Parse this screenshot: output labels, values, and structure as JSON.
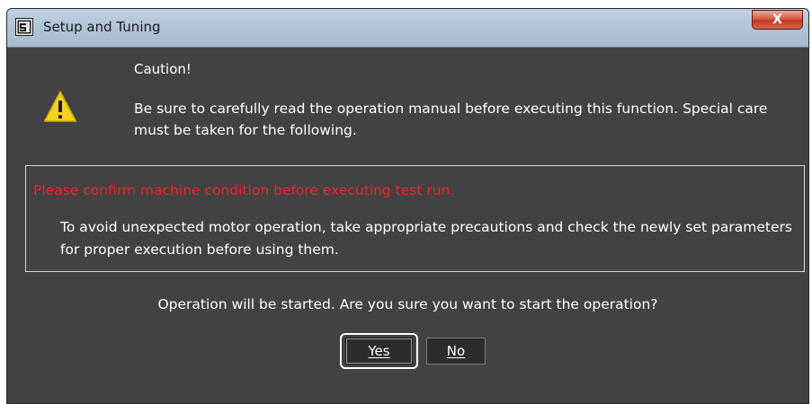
{
  "window": {
    "title": "Setup and Tuning",
    "close_label": "X"
  },
  "caution": {
    "title": "Caution!",
    "message": "Be sure to carefully read the operation manual before executing this function. Special care must be taken for the following."
  },
  "notice": {
    "warning": "Please confirm machine condition before executing test run.",
    "body": "To avoid unexpected motor operation, take appropriate precautions and check the newly set parameters for proper execution before using them."
  },
  "confirm": {
    "question": "Operation will be started. Are you sure you want to start the operation?"
  },
  "buttons": {
    "yes": "Yes",
    "no": "No"
  },
  "colors": {
    "background": "#404244",
    "warning_text": "#f4202a",
    "warning_icon_fill": "#f5d21b"
  },
  "icons": {
    "app": "app-window-icon",
    "warning": "warning-triangle-icon",
    "close": "close-icon"
  }
}
